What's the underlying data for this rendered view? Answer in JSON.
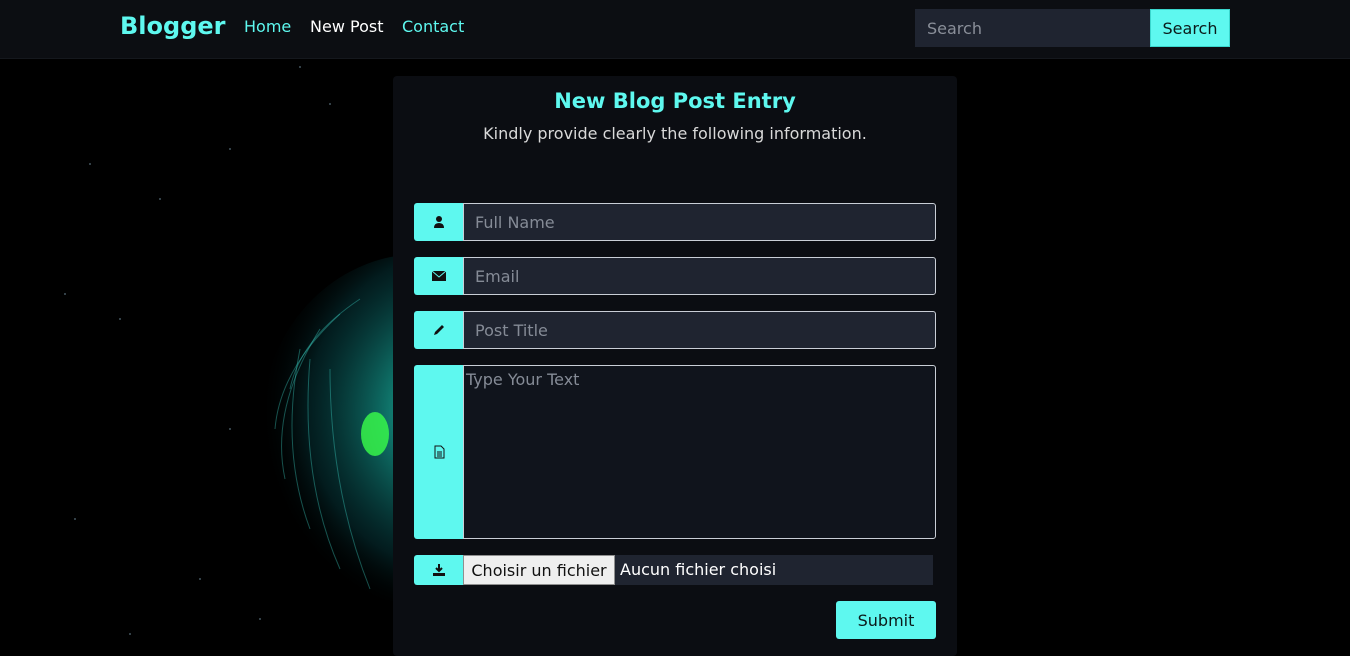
{
  "nav": {
    "brand": "Blogger",
    "links": [
      "Home",
      "New Post",
      "Contact"
    ],
    "search_placeholder": "Search",
    "search_button": "Search"
  },
  "form": {
    "title": "New Blog Post Entry",
    "subtitle": "Kindly provide clearly the following information.",
    "name_placeholder": "Full Name",
    "email_placeholder": "Email",
    "post_title_placeholder": "Post Title",
    "text_placeholder": "Type Your Text",
    "file_button": "Choisir un fichier",
    "file_status": "Aucun fichier choisi",
    "submit": "Submit"
  },
  "icons": [
    "user-icon",
    "envelope-icon",
    "pencil-icon",
    "document-icon",
    "download-icon"
  ],
  "colors": {
    "accent": "#5ef8ef",
    "navbar": "#0c0e12",
    "field_bg": "#1f2430",
    "card_bg": "#0b0d12"
  }
}
